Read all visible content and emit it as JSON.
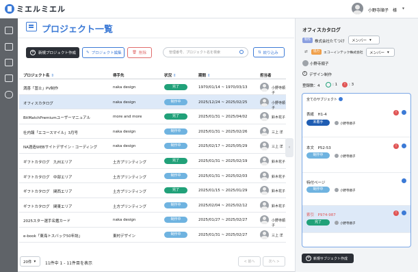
{
  "header": {
    "logo": "ミエルミエル",
    "user": "小野寺順子",
    "user_suffix": "様"
  },
  "page": {
    "title": "プロジェクト一覧"
  },
  "toolbar": {
    "create": "新規プロジェクト作成",
    "edit": "プロジェクト編集",
    "delete": "削除",
    "search_placeholder": "管理番号、プロジェクト名を検索",
    "filter": "絞り込み"
  },
  "table": {
    "headers": {
      "name": "プロジェクト名",
      "client": "得手先",
      "status": "状況",
      "period": "期間",
      "assignee": "担当者"
    },
    "rows": [
      {
        "name": "満喜「冨士」PV制作",
        "client": "naka design",
        "status": "完了",
        "period": "1970/01/14 ~ 1970/03/13",
        "assignee": "小野寺順子"
      },
      {
        "name": "オフィスカタログ",
        "client": "naka design",
        "status": "制作中",
        "period": "2025/12/24 ~ 2025/02/25",
        "assignee": "小野寺順子"
      },
      {
        "name": "BitMatchPremiumユーザーマニュアル",
        "client": "more and more",
        "status": "完了",
        "period": "2025/01/31 ~ 2025/04/02",
        "assignee": "鈴木花子"
      },
      {
        "name": "社内報「エコースマイル」3月号",
        "client": "naka design",
        "status": "制作中",
        "period": "2025/01/31 ~ 2025/02/26",
        "assignee": "三上 洋"
      },
      {
        "name": "NA酒造WEBサイトデザイン・コーディング",
        "client": "naka design",
        "status": "制作中",
        "period": "2025/02/17 ~ 2025/05/29",
        "assignee": "三上 洋"
      },
      {
        "name": "ギフトカタログ　九州エリア",
        "client": "土方プリンティング",
        "status": "完了",
        "period": "2025/01/31 ~ 2025/02/19",
        "assignee": "鈴木花子"
      },
      {
        "name": "ギフトカタログ　中部エリア",
        "client": "土方プリンティング",
        "status": "制作中",
        "period": "2025/01/31 ~ 2025/02/03",
        "assignee": "鈴木花子"
      },
      {
        "name": "ギフトカタログ　関西エリア",
        "client": "土方プリンティング",
        "status": "完了",
        "period": "2025/01/15 ~ 2025/01/29",
        "assignee": "鈴木花子"
      },
      {
        "name": "ギフトカタログ　関東エリア",
        "client": "土方プリンティング",
        "status": "制作中",
        "period": "2025/02/04 ~ 2025/02/12",
        "assignee": "鈴木花子"
      },
      {
        "name": "2025スター選手名鑑カード",
        "client": "naka design",
        "status": "制作中",
        "period": "2025/01/27 ~ 2025/02/27",
        "assignee": "小野寺順子"
      },
      {
        "name": "e-book「東海トスバック50年誌」",
        "client": "東村デザイン",
        "status": "制作中",
        "period": "2025/01/31 ~ 2025/02/27",
        "assignee": "三上 洋"
      }
    ]
  },
  "pager": {
    "per_page": "20件",
    "summary": "11件中 1 - 11件目を表示",
    "prev": "< 前へ",
    "next": "次へ >"
  },
  "detail": {
    "title": "オフィスカタログ",
    "tag_production": "制作",
    "client": "株式会社たてつけ",
    "client_role": "メンバー",
    "tag_partner": "協力",
    "partner": "エコーインテック株式会社",
    "partner_role": "メンバー",
    "owner": "小野寺順子",
    "category": "デザイン制作",
    "count_label": "登録数：4",
    "ok_count": ": 1",
    "warn_count": ": 3",
    "subtasks_title": "全てのサブジェクト",
    "subtasks": [
      {
        "name": "表紙　H1-4",
        "status": "未着手",
        "person": "小野寺順子"
      },
      {
        "name": "本文　P52-53",
        "status": "制作中",
        "person": "小野寺順子"
      },
      {
        "name": "特付ページ",
        "status": "制作中",
        "person": "小野寺順子"
      },
      {
        "name": "索引　P974-987",
        "status": "完了",
        "person": "小野寺順子"
      }
    ],
    "new_sub": "新規サブジェクト作成"
  }
}
